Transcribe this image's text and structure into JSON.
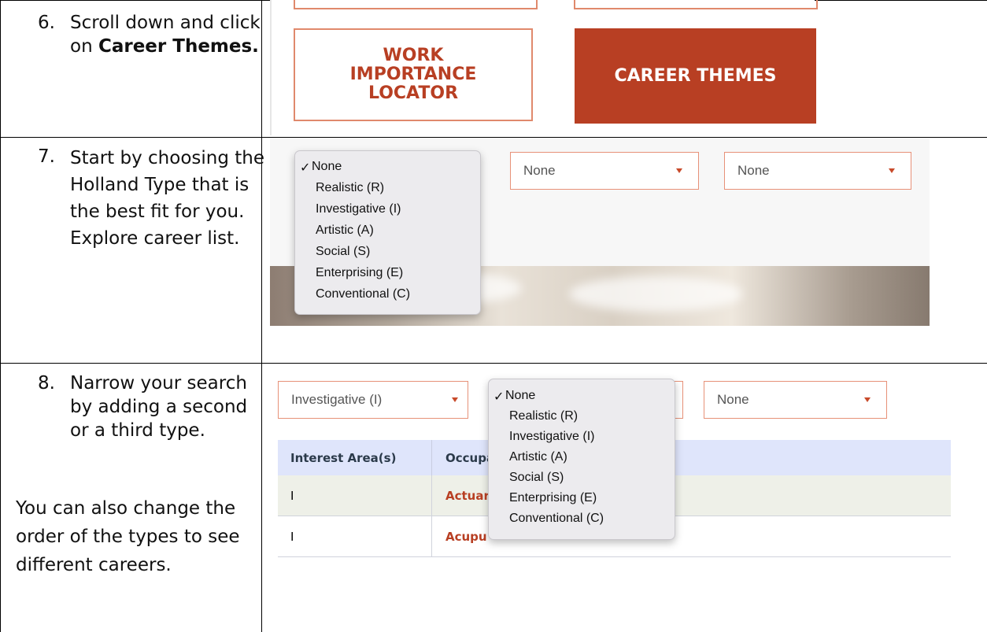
{
  "steps": [
    {
      "number": "6.",
      "text_before": "Scroll down and click on ",
      "text_bold": "Career Themes."
    },
    {
      "number": "7.",
      "text": "Start by choosing the Holland Type that is the best fit for you. Explore career list."
    },
    {
      "number": "8.",
      "text": "Narrow your search by adding a second or a third type.",
      "note": "You can also change the order of the types to see different careers."
    }
  ],
  "screenshot1": {
    "work_importance_button": "WORK IMPORTANCE LOCATOR",
    "career_themes_button": "CAREER THEMES"
  },
  "screenshot2": {
    "dropdown_options": [
      "None",
      "Realistic (R)",
      "Investigative (I)",
      "Artistic (A)",
      "Social (S)",
      "Enterprising (E)",
      "Conventional (C)"
    ],
    "selected_option": "None",
    "check_mark": "✓",
    "select2_value": "None",
    "select3_value": "None"
  },
  "screenshot3": {
    "select1_value": "Investigative (I)",
    "select3_value": "None",
    "dropdown_options": [
      "None",
      "Realistic (R)",
      "Investigative (I)",
      "Artistic (A)",
      "Social (S)",
      "Enterprising (E)",
      "Conventional (C)"
    ],
    "check_mark": "✓",
    "table_headers": [
      "Interest Area(s)",
      "Occupa"
    ],
    "rows": [
      {
        "interest": "I",
        "occupation": "Actuar"
      },
      {
        "interest": "I",
        "occupation": "Acupu"
      }
    ]
  },
  "colors": {
    "accent": "#b83f23",
    "select_border": "#e79178",
    "table_header_bg": "#dfe5fb",
    "row_highlight_bg": "#eef0e8"
  }
}
